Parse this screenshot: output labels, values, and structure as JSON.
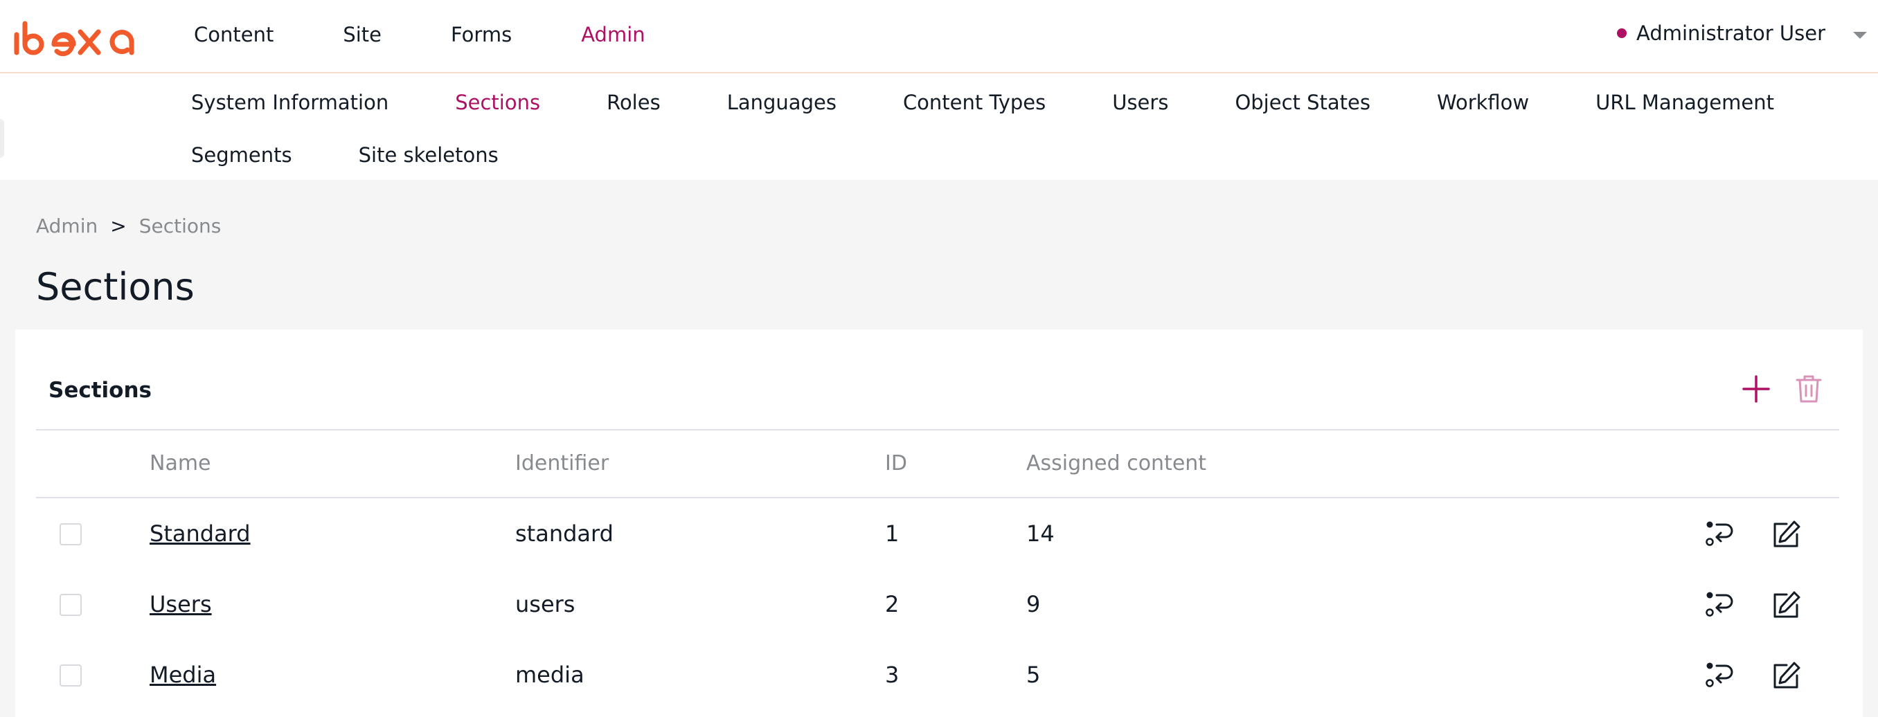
{
  "brand": {
    "logo_text": "ibexa",
    "accent_color": "#ae1164",
    "logo_color": "#f15a2a"
  },
  "main_nav": [
    {
      "label": "Content",
      "active": false
    },
    {
      "label": "Site",
      "active": false
    },
    {
      "label": "Forms",
      "active": false
    },
    {
      "label": "Admin",
      "active": true
    }
  ],
  "user": {
    "name": "Administrator User",
    "status_icon": "status-dot",
    "menu_icon": "caret-down-icon"
  },
  "sub_nav": {
    "row1": [
      {
        "label": "System Information",
        "active": false
      },
      {
        "label": "Sections",
        "active": true
      },
      {
        "label": "Roles",
        "active": false
      },
      {
        "label": "Languages",
        "active": false
      },
      {
        "label": "Content Types",
        "active": false
      },
      {
        "label": "Users",
        "active": false
      },
      {
        "label": "Object States",
        "active": false
      },
      {
        "label": "Workflow",
        "active": false
      },
      {
        "label": "URL Management",
        "active": false
      }
    ],
    "row2": [
      {
        "label": "Segments",
        "active": false
      },
      {
        "label": "Site skeletons",
        "active": false
      }
    ]
  },
  "breadcrumb": {
    "items": [
      "Admin",
      "Sections"
    ],
    "separator": ">"
  },
  "page_title": "Sections",
  "panel": {
    "title": "Sections",
    "actions": [
      {
        "name": "create",
        "icon": "plus-icon",
        "enabled": true
      },
      {
        "name": "delete",
        "icon": "trash-icon",
        "enabled": false
      }
    ],
    "columns": {
      "name": "Name",
      "identifier": "Identifier",
      "id": "ID",
      "assigned": "Assigned content"
    },
    "rows": [
      {
        "name": "Standard",
        "identifier": "standard",
        "id": "1",
        "assigned": "14",
        "checked": false
      },
      {
        "name": "Users",
        "identifier": "users",
        "id": "2",
        "assigned": "9",
        "checked": false
      },
      {
        "name": "Media",
        "identifier": "media",
        "id": "3",
        "assigned": "5",
        "checked": false
      }
    ],
    "row_actions": [
      {
        "name": "assign-content",
        "icon": "assign-content-icon"
      },
      {
        "name": "edit",
        "icon": "edit-icon"
      }
    ]
  }
}
